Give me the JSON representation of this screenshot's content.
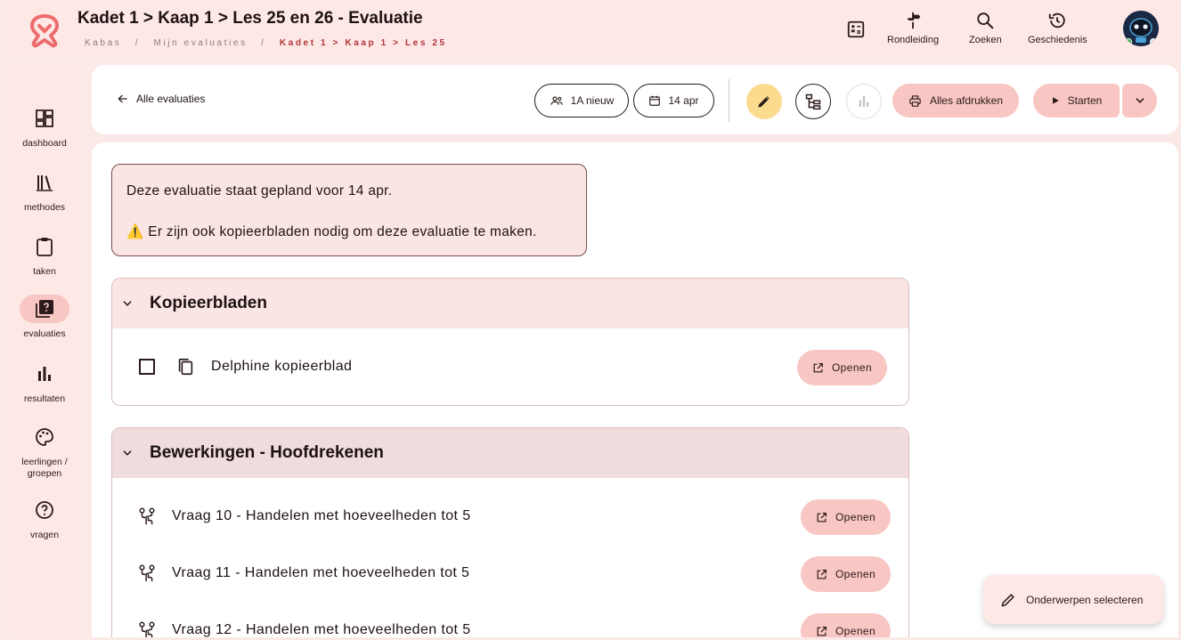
{
  "header": {
    "title": "Kadet 1 > Kaap 1 > Les 25 en 26 - Evaluatie",
    "breadcrumb": {
      "root": "Kabas",
      "sep1": "/",
      "middle": "Mijn evaluaties",
      "sep2": "/",
      "current": "Kadet 1 > Kaap 1 > Les 25"
    },
    "actions": {
      "rondleiding": "Rondleiding",
      "zoeken": "Zoeken",
      "geschiedenis": "Geschiedenis"
    }
  },
  "sidebar": {
    "items": [
      {
        "label": "dashboard",
        "icon": "dashboard-icon"
      },
      {
        "label": "methodes",
        "icon": "books-icon"
      },
      {
        "label": "taken",
        "icon": "clipboard-icon"
      },
      {
        "label": "evaluaties",
        "icon": "quiz-icon"
      },
      {
        "label": "resultaten",
        "icon": "bar-chart-icon"
      },
      {
        "label": "leerlingen / groepen",
        "icon": "palette-icon"
      },
      {
        "label": "vragen",
        "icon": "help-circle-icon"
      }
    ],
    "active": "evaluaties"
  },
  "toolbar": {
    "back_label": "Alle evaluaties",
    "group_label": "1A nieuw",
    "date_label": "14 apr",
    "print_label": "Alles afdrukken",
    "start_label": "Starten"
  },
  "notice": {
    "line1": "Deze evaluatie staat gepland voor 14 apr.",
    "warning_icon": "⚠️",
    "line2": "Er zijn ook kopieerbladen nodig om deze evaluatie te maken."
  },
  "sections": {
    "kopieerbladen": {
      "title": "Kopieerbladen",
      "items": [
        {
          "label": "Delphine kopieerblad",
          "action": "Openen"
        }
      ]
    },
    "bewerkingen": {
      "title": "Bewerkingen - Hoofdrekenen",
      "items": [
        {
          "label": "Vraag 10 - Handelen met hoeveelheden tot 5",
          "action": "Openen"
        },
        {
          "label": "Vraag 11 - Handelen met hoeveelheden tot 5",
          "action": "Openen"
        },
        {
          "label": "Vraag 12 - Handelen met hoeveelheden tot 5",
          "action": "Openen"
        }
      ]
    }
  },
  "fab": {
    "label": "Onderwerpen selecteren"
  },
  "colors": {
    "accent_pink": "#f8c6c3",
    "header_bg": "#fde8e6",
    "brand_red": "#b0343a",
    "edit_yellow": "#fbdc8e"
  }
}
